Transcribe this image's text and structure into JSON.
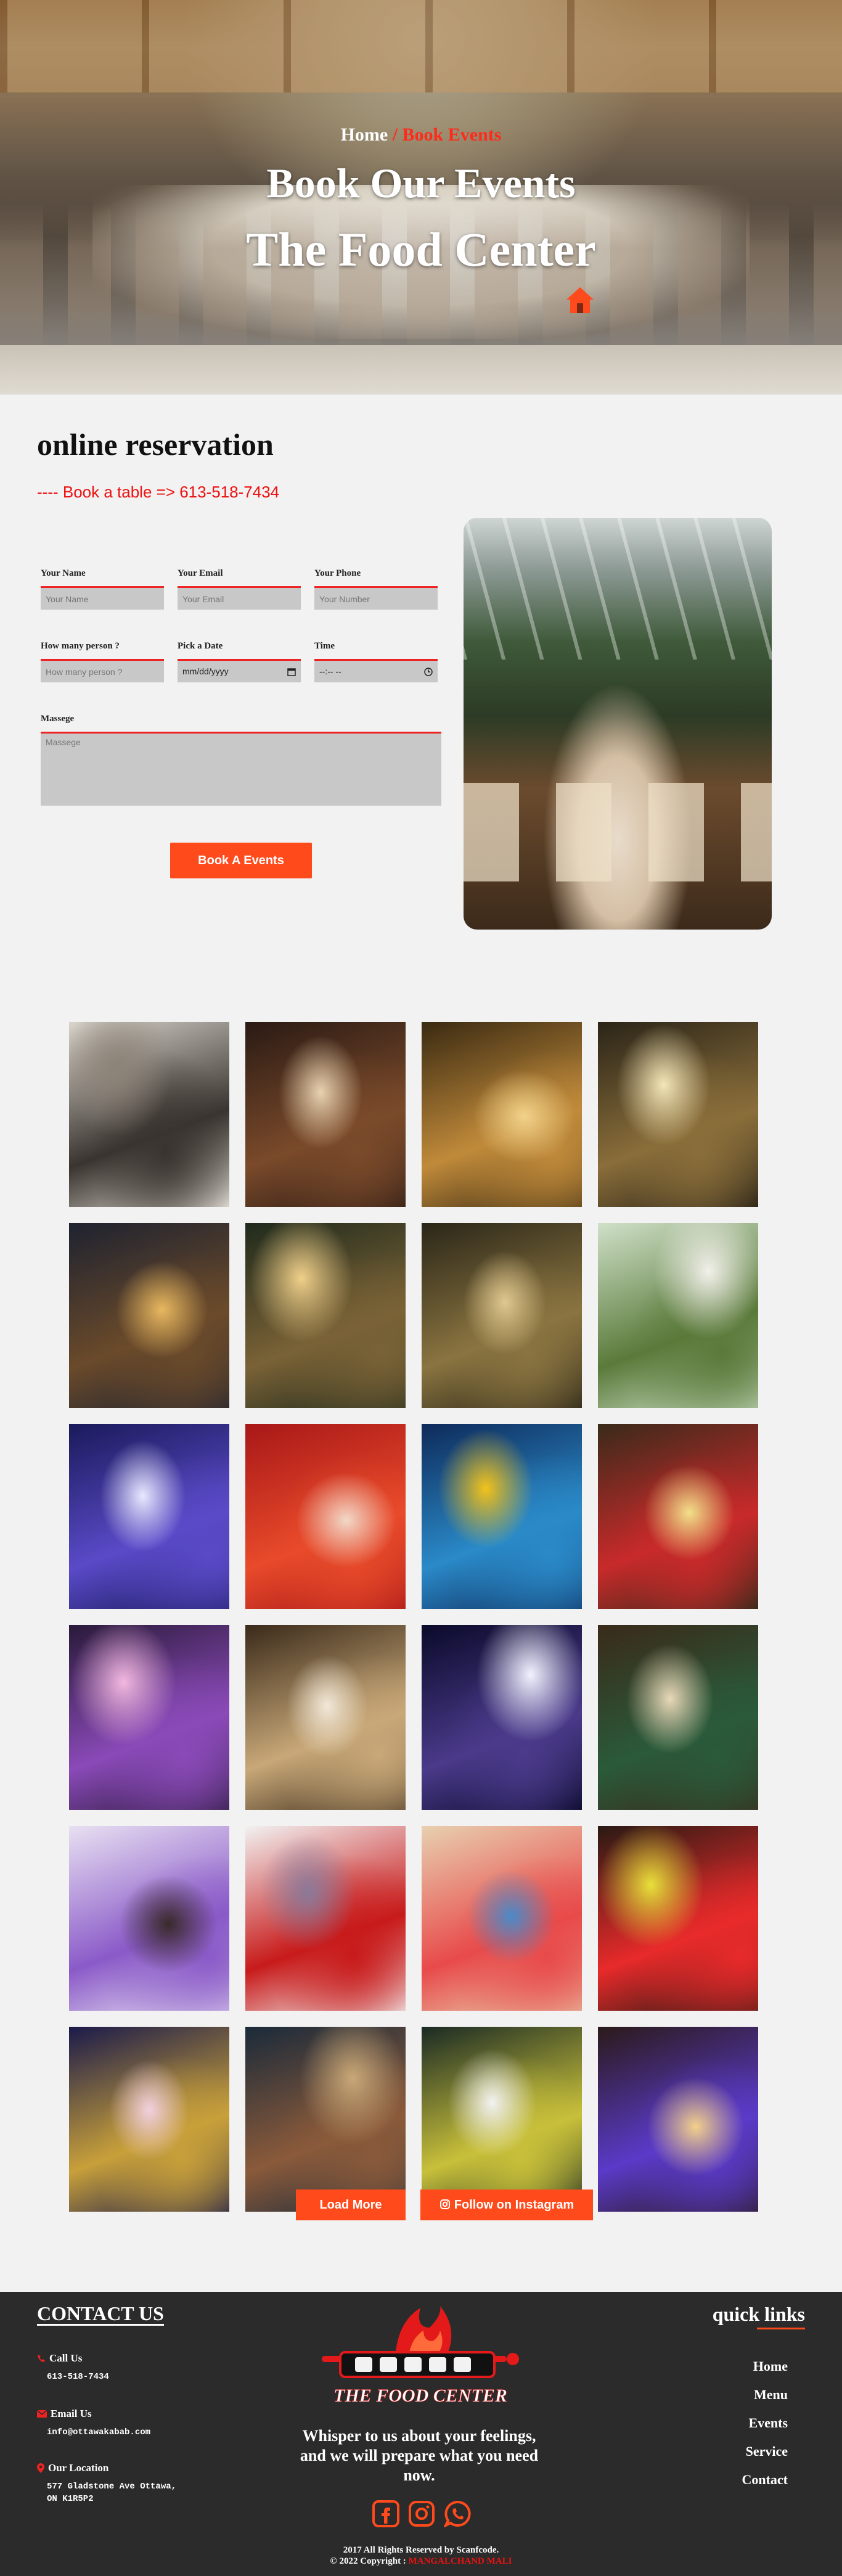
{
  "hero": {
    "breadcrumb_home": "Home",
    "breadcrumb_sep": "/",
    "breadcrumb_current": "Book Events",
    "heading": "Book Our Events",
    "subheading": "The Food Center",
    "home_icon": "home-icon"
  },
  "reservation": {
    "title": "online reservation",
    "phone_line": "---- Book a table => 613-518-7434",
    "fields": {
      "name_label": "Your Name",
      "name_placeholder": "Your Name",
      "email_label": "Your Email",
      "email_placeholder": "Your Email",
      "phone_label": "Your Phone",
      "phone_placeholder": "Your Number",
      "persons_label": "How many person ?",
      "persons_placeholder": "How many person ?",
      "date_label": "Pick a Date",
      "date_value": "mm/dd/yyyy",
      "time_label": "Time",
      "time_value": "--:-- --",
      "message_label": "Massege",
      "message_placeholder": "Massege"
    },
    "submit_label": "Book A Events"
  },
  "gallery": {
    "images": [
      {
        "name": "fine-dining-plate",
        "c1": "#d9d4cc",
        "c2": "#3a3430",
        "c3": "#8c8377"
      },
      {
        "name": "dark-banquet-hall",
        "c1": "#2a1a14",
        "c2": "#7a4a2a",
        "c3": "#e8d2b0"
      },
      {
        "name": "golden-restaurant-interior",
        "c1": "#3a2a12",
        "c2": "#c08a3a",
        "c3": "#f2d28a"
      },
      {
        "name": "chandelier-dining-room",
        "c1": "#2a2418",
        "c2": "#8a6e3a",
        "c3": "#f4e6b8"
      },
      {
        "name": "patio-night-tables",
        "c1": "#1e2230",
        "c2": "#6a4a2a",
        "c3": "#e8b860"
      },
      {
        "name": "garden-string-lights",
        "c1": "#1f2a1c",
        "c2": "#7a6236",
        "c3": "#f0d08a"
      },
      {
        "name": "greenery-corridor",
        "c1": "#2a2618",
        "c2": "#8a7440",
        "c3": "#e0c890"
      },
      {
        "name": "outdoor-garden-tables",
        "c1": "#cfe0c8",
        "c2": "#5a7a3a",
        "c3": "#f2f0ea"
      },
      {
        "name": "purple-lit-banquet",
        "c1": "#1a1a5a",
        "c2": "#5a4ac8",
        "c3": "#e8e8ff"
      },
      {
        "name": "events-party-venue",
        "c1": "#a81818",
        "c2": "#e84a2a",
        "c3": "#f2d8c8"
      },
      {
        "name": "birthday-party-flyer",
        "c1": "#0e2a5a",
        "c2": "#2a8ac8",
        "c3": "#f2c21a"
      },
      {
        "name": "balloon-decor-hall",
        "c1": "#3a2a1a",
        "c2": "#c82a2a",
        "c3": "#f2e08a"
      },
      {
        "name": "violet-party-room",
        "c1": "#2a1a3a",
        "c2": "#8a4ab8",
        "c3": "#f2b8e0"
      },
      {
        "name": "dance-floor-dj",
        "c1": "#3a2a1a",
        "c2": "#c8a878",
        "c3": "#f2e8d8"
      },
      {
        "name": "white-draped-ballroom",
        "c1": "#0a0a2a",
        "c2": "#4a3a8a",
        "c3": "#f2f2ff"
      },
      {
        "name": "green-table-banquet",
        "c1": "#3a2a1a",
        "c2": "#2a5a3a",
        "c3": "#e8d8b8"
      },
      {
        "name": "purple-ceiling-lounge",
        "c1": "#e8e0f2",
        "c2": "#8a5ac8",
        "c3": "#3a2a2a"
      },
      {
        "name": "party-hall-discount-flyer",
        "c1": "#f2f2f2",
        "c2": "#c81a1a",
        "c3": "#8a7a9a"
      },
      {
        "name": "colorful-canopy-cafe",
        "c1": "#e8d0b0",
        "c2": "#e84a4a",
        "c3": "#4a8ac8"
      },
      {
        "name": "red-seating-lounge",
        "c1": "#2a1a14",
        "c2": "#e82a2a",
        "c3": "#e8e03a"
      },
      {
        "name": "celebrate-special-days",
        "c1": "#1a1a4a",
        "c2": "#c8a03a",
        "c3": "#f2d0e0"
      },
      {
        "name": "maestro-storefront",
        "c1": "#1a2a3a",
        "c2": "#8a5a3a",
        "c3": "#c8a878"
      },
      {
        "name": "white-chairs-garden-room",
        "c1": "#1a2a24",
        "c2": "#c8c03a",
        "c3": "#f2f2f2"
      },
      {
        "name": "star-lights-bar",
        "c1": "#2a1a1a",
        "c2": "#5a3ac8",
        "c3": "#f2d08a"
      }
    ],
    "load_more_label": "Load More",
    "instagram_label": "Follow on Instagram",
    "instagram_icon": "instagram-icon"
  },
  "footer": {
    "contact_heading": "CONTACT US",
    "call_label": "Call Us",
    "call_value": "613-518-7434",
    "email_label": "Email Us",
    "email_value": "info@ottawakabab.com",
    "location_label": "Our Location",
    "location_line1": "577 Gladstone Ave Ottawa,",
    "location_line2": "ON K1R5P2",
    "logo_text": "THE FOOD CENTER",
    "whisper": "Whisper to us about your feelings, and we will prepare what you need now.",
    "quick_heading": "quick links",
    "links": [
      "Home",
      "Menu",
      "Events",
      "Service",
      "Contact"
    ],
    "copyright_line1": "2017 All Rights Reserved by Scanfcode.",
    "copyright_prefix": "© 2022 Copyright :",
    "copyright_author": "MANGALCHAND MALI",
    "accent_color": "#ff4a1c"
  }
}
